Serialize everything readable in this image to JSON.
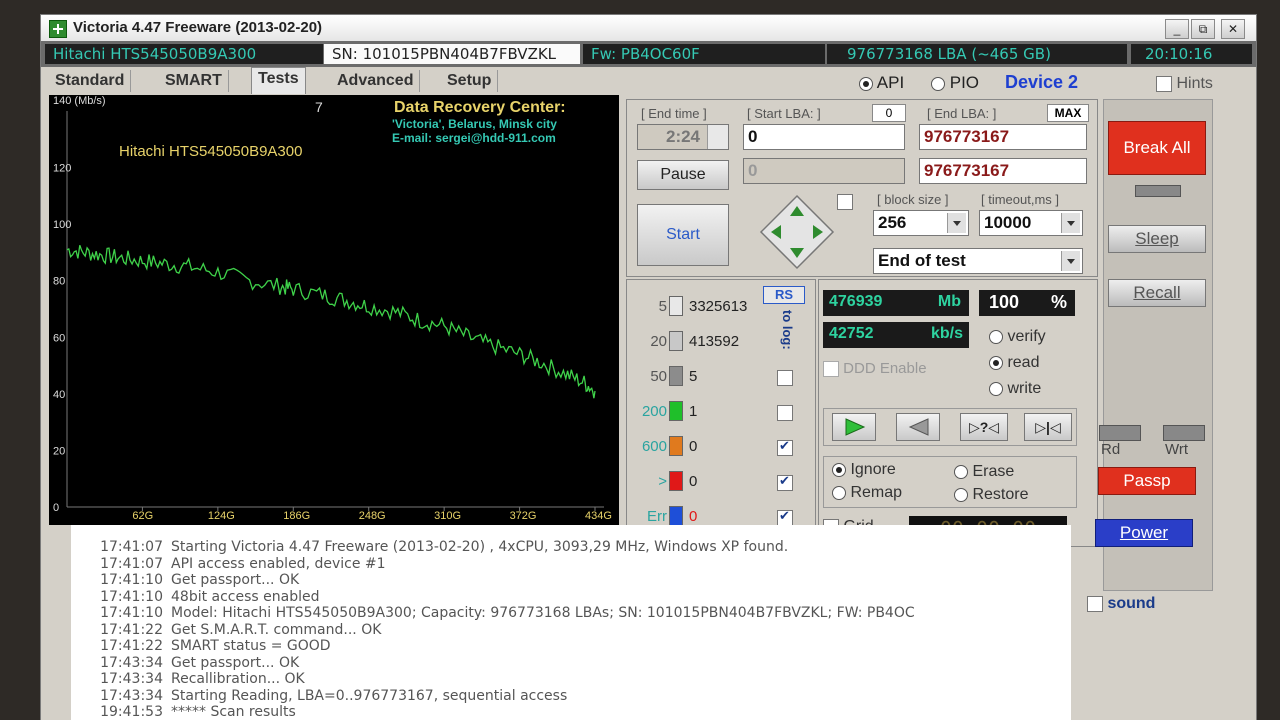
{
  "window": {
    "title": "Victoria 4.47  Freeware (2013-02-20)",
    "controls": [
      "_",
      "⧉",
      "✕"
    ]
  },
  "infobar": {
    "model": "Hitachi HTS545050B9A300",
    "serial": "SN: 101015PBN404B7FBVZKL",
    "firmware": "Fw: PB4OC60F",
    "capacity": "976773168 LBA (~465 GB)",
    "clock": "20:10:16"
  },
  "tabs": [
    "Standard",
    "SMART",
    "Tests",
    "Advanced",
    "Setup"
  ],
  "active_tab": "Tests",
  "mode": {
    "api": "API",
    "pio": "PIO",
    "device": "Device 2",
    "hints": "Hints"
  },
  "graph": {
    "yunit": "140 (Mb/s)",
    "counter": "7",
    "drive_label": "Hitachi HTS545050B9A300",
    "credit_title": "Data Recovery Center:",
    "credit_line1": "'Victoria', Belarus, Minsk city",
    "credit_line2": "E-mail: sergei@hdd-911.com",
    "color": "#3fd24a"
  },
  "chart_data": {
    "type": "line",
    "title": "",
    "xlabel": "",
    "ylabel": "140 (Mb/s)",
    "ylim": [
      0,
      140
    ],
    "yticks": [
      "0",
      "20",
      "40",
      "60",
      "80",
      "100",
      "120"
    ],
    "xticks": [
      "62G",
      "124G",
      "186G",
      "248G",
      "310G",
      "372G",
      "434G"
    ],
    "series": [
      {
        "x": [
          0,
          15,
          30,
          45,
          62,
          80,
          100,
          124,
          150,
          175,
          186,
          210,
          230,
          248,
          270,
          290,
          310,
          330,
          350,
          372,
          390,
          410,
          425,
          434
        ],
        "y": [
          91,
          90,
          89,
          88,
          87,
          86,
          85,
          83,
          80,
          78,
          77,
          75,
          73,
          71,
          69,
          66,
          64,
          60,
          57,
          54,
          51,
          47,
          44,
          41
        ]
      }
    ]
  },
  "test": {
    "end_time_label": "[ End time ]",
    "end_time": "2:24",
    "start_lba_label": "[ Start LBA: ]",
    "start_lba_zero": "0",
    "start_lba": "0",
    "start_lba_cur": "0",
    "end_lba_label": "[ End LBA: ]",
    "max_label": "MAX",
    "end_lba": "976773167",
    "end_lba_cur": "976773167",
    "pause": "Pause",
    "start": "Start",
    "block_size_label": "[ block size ]",
    "block_size": "256",
    "timeout_label": "[ timeout,ms ]",
    "timeout": "10000",
    "end_action": "End of test"
  },
  "stats": {
    "rs": "RS",
    "to_log": "to log:",
    "rows": [
      {
        "ms": "5",
        "count": "3325613",
        "color": "#e8e8e8",
        "log": null
      },
      {
        "ms": "20",
        "count": "413592",
        "color": "#c8c8c8",
        "log": null
      },
      {
        "ms": "50",
        "count": "5",
        "color": "#8c8c8c",
        "log": false
      },
      {
        "ms": "200",
        "count": "1",
        "color": "#1fbf2a",
        "log": false
      },
      {
        "ms": "600",
        "count": "0",
        "color": "#e07a1e",
        "log": true
      },
      {
        "ms": ">",
        "count": "0",
        "color": "#e01818",
        "log": true
      },
      {
        "ms": "Err",
        "count": "0",
        "color": "#1e4fd8",
        "log": true
      }
    ]
  },
  "progress": {
    "mb": "476939",
    "mb_unit": "Mb",
    "percent": "100",
    "percent_unit": "%",
    "speed": "42752",
    "speed_unit": "kb/s",
    "ddd": "DDD Enable",
    "verify": "verify",
    "read": "read",
    "write": "write",
    "ignore": "Ignore",
    "erase": "Erase",
    "remap": "Remap",
    "restore": "Restore",
    "grid": "Grid",
    "timer": "00:00:00"
  },
  "side": {
    "break_all": "Break All",
    "sleep": "Sleep",
    "recall": "Recall",
    "rd": "Rd",
    "wrt": "Wrt",
    "passp": "Passp",
    "power": "Power",
    "sound": "sound"
  },
  "log": [
    {
      "time": "17:41:07",
      "msg": "Starting Victoria 4.47  Freeware (2013-02-20) , 4xCPU, 3093,29 MHz, Windows XP found."
    },
    {
      "time": "17:41:07",
      "msg": "API access enabled, device #1"
    },
    {
      "time": "17:41:10",
      "msg": "Get passport... OK"
    },
    {
      "time": "17:41:10",
      "msg": "48bit access enabled"
    },
    {
      "time": "17:41:10",
      "msg": "Model: Hitachi HTS545050B9A300; Capacity: 976773168 LBAs; SN: 101015PBN404B7FBVZKL; FW: PB4OC"
    },
    {
      "time": "17:41:22",
      "msg": "Get S.M.A.R.T. command... OK"
    },
    {
      "time": "17:41:22",
      "msg": "SMART status = GOOD"
    },
    {
      "time": "17:43:34",
      "msg": "Get passport... OK"
    },
    {
      "time": "17:43:34",
      "msg": "Recallibration... OK"
    },
    {
      "time": "17:43:34",
      "msg": "Starting Reading, LBA=0..976773167, sequential access"
    },
    {
      "time": "19:41:53",
      "msg": "***** Scan results"
    }
  ]
}
